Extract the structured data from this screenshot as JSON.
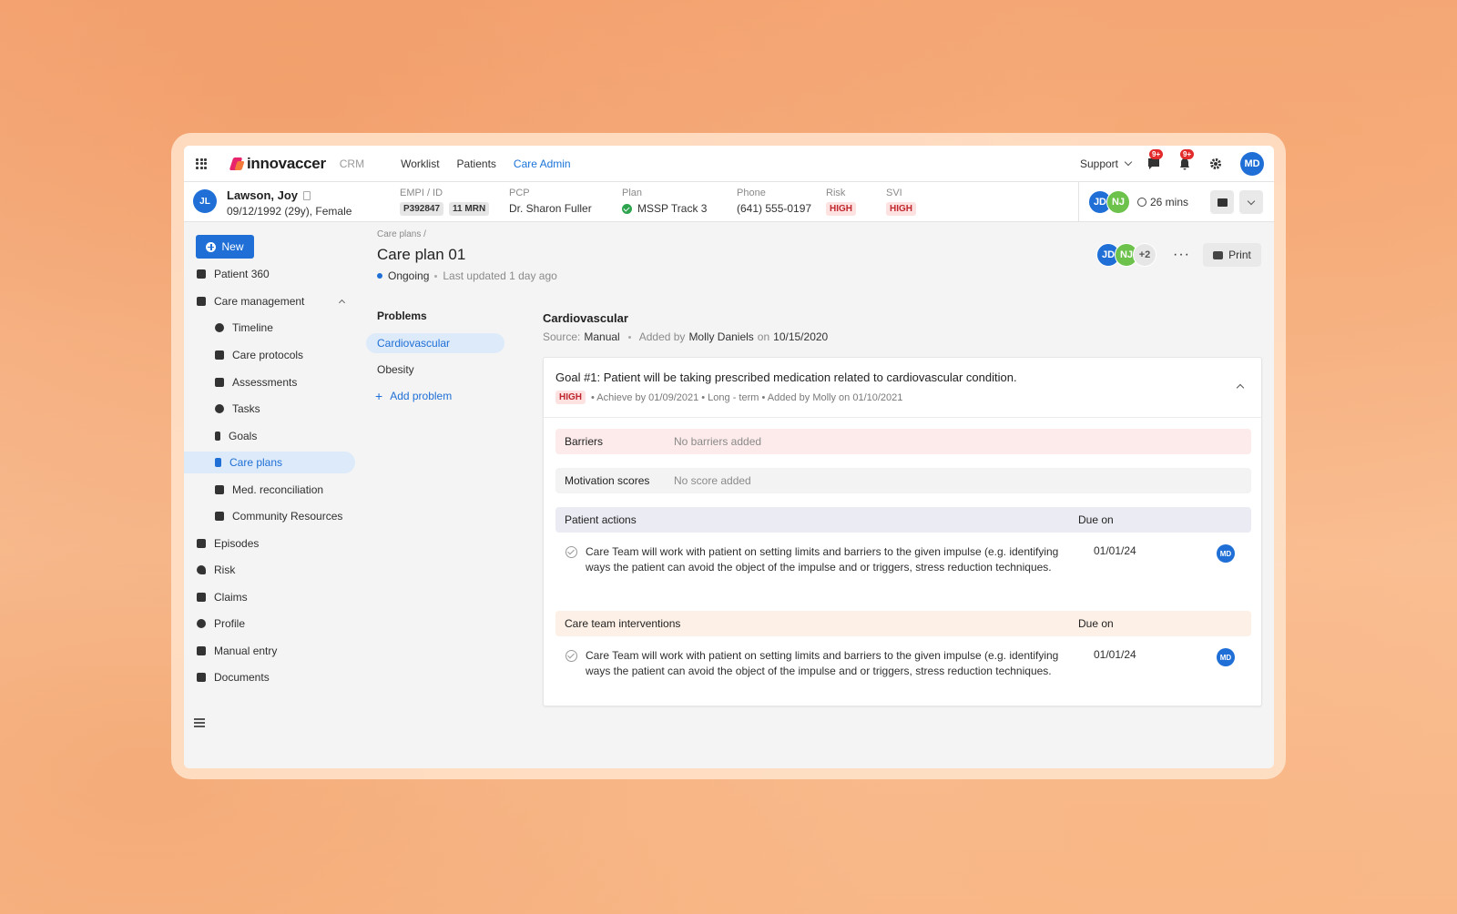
{
  "nav": {
    "brand": "innovaccer",
    "product": "CRM",
    "links": [
      "Worklist",
      "Patients",
      "Care Admin"
    ],
    "active_link": "Care Admin",
    "support_label": "Support",
    "messages_badge": "9+",
    "notifications_badge": "9+",
    "user_initials": "MD"
  },
  "patient": {
    "initials": "JL",
    "name": "Lawson, Joy",
    "dob": "09/12/1992 (29y), Female",
    "empi_label": "EMPI / ID",
    "empi_id": "P392847",
    "mrn": "11 MRN",
    "pcp_label": "PCP",
    "pcp": "Dr. Sharon Fuller",
    "plan_label": "Plan",
    "plan": "MSSP Track 3",
    "phone_label": "Phone",
    "phone": "(641) 555-0197",
    "risk_label": "Risk",
    "risk": "HIGH",
    "svi_label": "SVI",
    "svi": "HIGH",
    "team": [
      "JD",
      "NJ"
    ],
    "timer": "26 mins"
  },
  "sidebar": {
    "new_label": "New",
    "items": [
      {
        "label": "Patient 360",
        "level": 1
      },
      {
        "label": "Care management",
        "level": 1,
        "expanded": true
      },
      {
        "label": "Timeline",
        "level": 2
      },
      {
        "label": "Care protocols",
        "level": 2
      },
      {
        "label": "Assessments",
        "level": 2
      },
      {
        "label": "Tasks",
        "level": 2
      },
      {
        "label": "Goals",
        "level": 2
      },
      {
        "label": "Care plans",
        "level": 2,
        "active": true
      },
      {
        "label": "Med. reconciliation",
        "level": 2
      },
      {
        "label": "Community Resources",
        "level": 2
      },
      {
        "label": "Episodes",
        "level": 1
      },
      {
        "label": "Risk",
        "level": 1
      },
      {
        "label": "Claims",
        "level": 1
      },
      {
        "label": "Profile",
        "level": 1
      },
      {
        "label": "Manual entry",
        "level": 1
      },
      {
        "label": "Documents",
        "level": 1
      }
    ]
  },
  "main": {
    "breadcrumb": "Care plans /",
    "title": "Care plan 01",
    "status": "Ongoing",
    "updated": "Last updated 1 day ago",
    "collaborators": [
      "JD",
      "NJ"
    ],
    "collaborators_more": "+2",
    "more_label": "···",
    "print_label": "Print",
    "problems_heading": "Problems",
    "problems": [
      "Cardiovascular",
      "Obesity"
    ],
    "add_problem": "Add problem",
    "section": {
      "title": "Cardiovascular",
      "source_label": "Source:",
      "source": "Manual",
      "added_by_label": "Added by",
      "added_by": "Molly Daniels",
      "on_label": "on",
      "added_on": "10/15/2020"
    },
    "goal": {
      "title": "Goal #1: Patient will be taking prescribed medication related to cardiovascular condition.",
      "priority": "HIGH",
      "meta": "• Achieve by 01/09/2021 • Long - term • Added by Molly on 01/10/2021"
    },
    "barriers": {
      "label": "Barriers",
      "value": "No barriers added"
    },
    "motivation": {
      "label": "Motivation scores",
      "value": "No score added"
    },
    "patient_actions": {
      "label": "Patient actions",
      "due_label": "Due on",
      "items": [
        {
          "text": "Care Team will work with patient on setting limits and barriers to the given impulse (e.g. identifying ways the patient can avoid the object of the impulse and or triggers, stress reduction techniques.",
          "due": "01/01/24",
          "owner": "MD"
        }
      ]
    },
    "interventions": {
      "label": "Care team interventions",
      "due_label": "Due on",
      "items": [
        {
          "text": "Care Team will work with patient on setting limits and barriers to the given impulse (e.g. identifying ways the patient can avoid the object of the impulse and or triggers, stress reduction techniques.",
          "due": "01/01/24",
          "owner": "MD"
        }
      ]
    }
  },
  "colors": {
    "accent": "#1f6fd6",
    "danger": "#c0262d",
    "success": "#2ea44f",
    "brand_pink": "#e8246c",
    "brand_orange": "#f47a3c"
  }
}
